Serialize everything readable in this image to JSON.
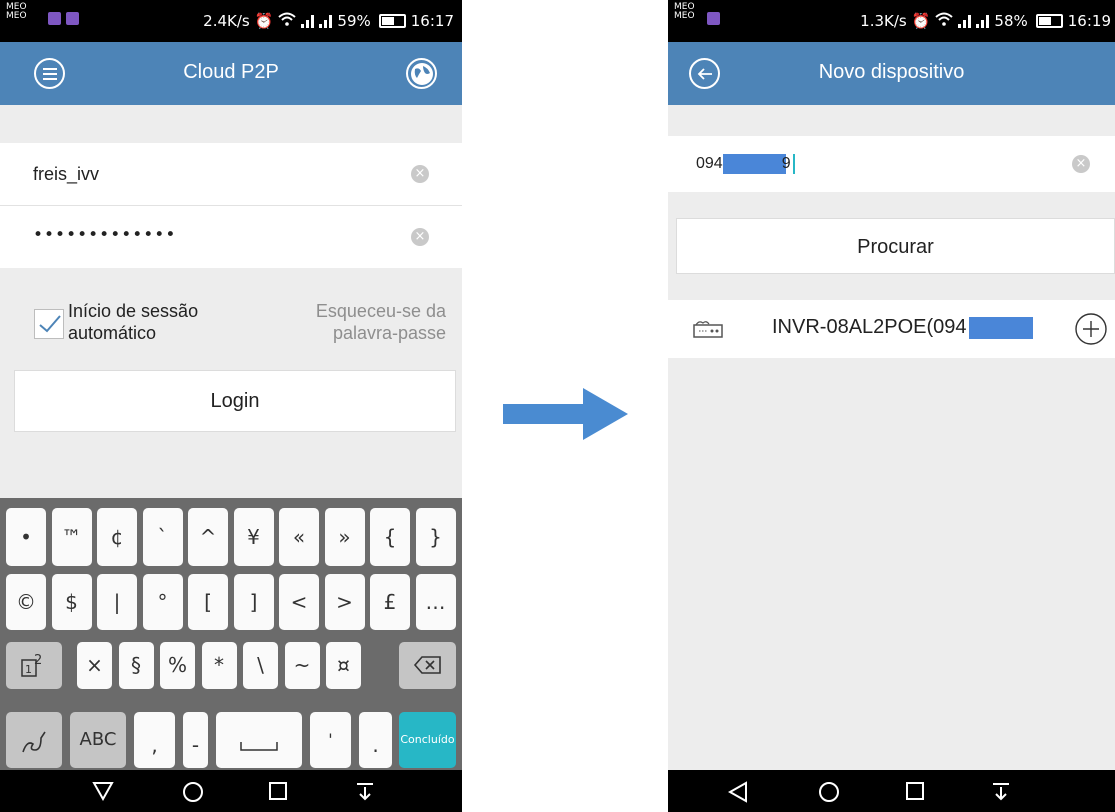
{
  "left_screen": {
    "status": {
      "carrier": [
        "MEO",
        "MEO"
      ],
      "speed": "2.4K/s",
      "battery": "59%",
      "battery_level": 0.59,
      "time": "16:17"
    },
    "app_title": "Cloud P2P",
    "username": "freis_ivv",
    "password_mask": "•••••••••••••",
    "auto_login_label_line1": "Início de sessão",
    "auto_login_label_line2": "automático",
    "auto_login_checked": true,
    "forgot_line1": "Esqueceu-se da",
    "forgot_line2": "palavra-passe",
    "login_label": "Login",
    "keyboard": {
      "row1": [
        "•",
        "™",
        "¢",
        "`",
        "^",
        "¥",
        "«",
        "»",
        "{",
        "}"
      ],
      "row2": [
        "©",
        "$",
        "|",
        "°",
        "[",
        "]",
        "<",
        ">",
        "£",
        "…"
      ],
      "row3_mode": "?12",
      "row3": [
        "×",
        "§",
        "%",
        "*",
        "\\",
        "~",
        "¤"
      ],
      "row4_abc": "ABC",
      "row4_comma": ",",
      "row4_dash": "-",
      "row4_quote": "'",
      "row4_dot": ".",
      "done_label": "Concluído"
    }
  },
  "right_screen": {
    "status": {
      "carrier": [
        "MEO",
        "MEO"
      ],
      "speed": "1.3K/s",
      "battery": "58%",
      "battery_level": 0.58,
      "time": "16:19"
    },
    "app_title": "Novo dispositivo",
    "device_id_prefix": "094",
    "device_id_suffix": "9",
    "search_label": "Procurar",
    "device_name": "INVR-08AL2POE(094"
  },
  "colors": {
    "appbar": "#4d84b7",
    "redaction": "#4a86d8",
    "arrow": "#4a8bd1",
    "done_key": "#27b7c6"
  }
}
